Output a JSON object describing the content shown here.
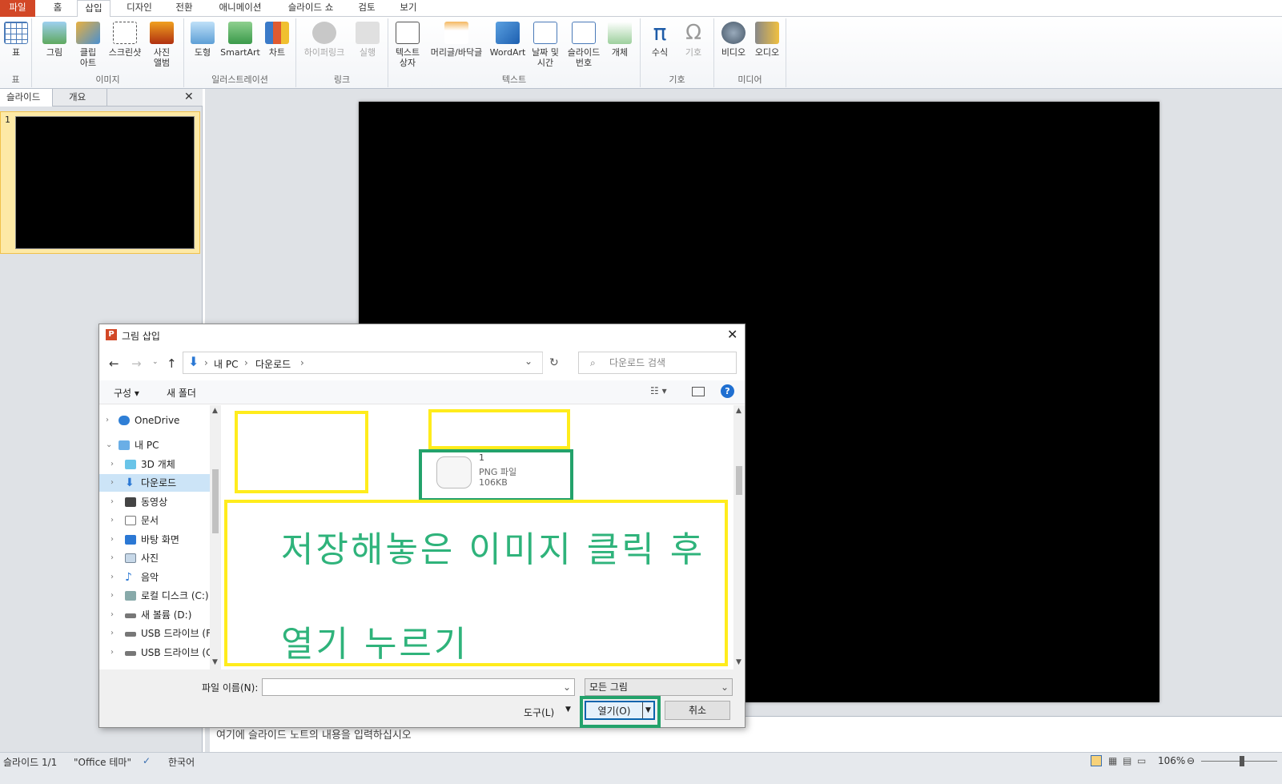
{
  "ribbon_tabs": [
    "파일",
    "홈",
    "삽입",
    "디자인",
    "전환",
    "애니메이션",
    "슬라이드 쇼",
    "검토",
    "보기"
  ],
  "groups": {
    "table": "표",
    "images": "이미지",
    "illust": "일러스트레이션",
    "links": "링크",
    "text": "텍스트",
    "symbols": "기호",
    "media": "미디어"
  },
  "buttons": {
    "table": "표",
    "picture": "그림",
    "clipart": "클립\n아트",
    "screenshot": "스크린샷",
    "album": "사진\n앨범",
    "shapes": "도형",
    "smartart": "SmartArt",
    "chart": "차트",
    "hyperlink": "하이퍼링크",
    "action": "실행",
    "textbox": "텍스트\n상자",
    "header": "머리글/바닥글",
    "wordart": "WordArt",
    "datetime": "날짜 및\n시간",
    "slidenum": "슬라이드\n번호",
    "object": "개체",
    "equation": "수식",
    "symbol": "기호",
    "video": "비디오",
    "audio": "오디오"
  },
  "pane_tabs": {
    "slides": "슬라이드",
    "outline": "개요"
  },
  "slide_number": "1",
  "notes_placeholder": "여기에 슬라이드 노트의 내용을 입력하십시오",
  "status": {
    "slide": "슬라이드 1/1",
    "theme": "\"Office 테마\"",
    "lang": "한국어",
    "zoom": "106%"
  },
  "dialog": {
    "title": "그림 삽입",
    "breadcrumb": [
      "내 PC",
      "다운로드"
    ],
    "search_placeholder": "다운로드 검색",
    "organize": "구성 ▾",
    "new_folder": "새 폴더",
    "nav": [
      "OneDrive",
      "내 PC",
      "3D 개체",
      "다운로드",
      "동영상",
      "문서",
      "바탕 화면",
      "사진",
      "음악",
      "로컬 디스크 (C:)",
      "새 볼륨 (D:)",
      "USB 드라이브 (F",
      "USB 드라이브 (C"
    ],
    "file": {
      "name": "1",
      "type": "PNG 파일",
      "size": "106KB"
    },
    "annotation_line1": "저장해놓은 이미지 클릭 후",
    "annotation_line2": "열기 누르기",
    "filename_label": "파일 이름(N):",
    "filetype_value": "모든 그림",
    "tools_label": "도구(L)",
    "open_label": "열기(O)",
    "cancel_label": "취소"
  }
}
